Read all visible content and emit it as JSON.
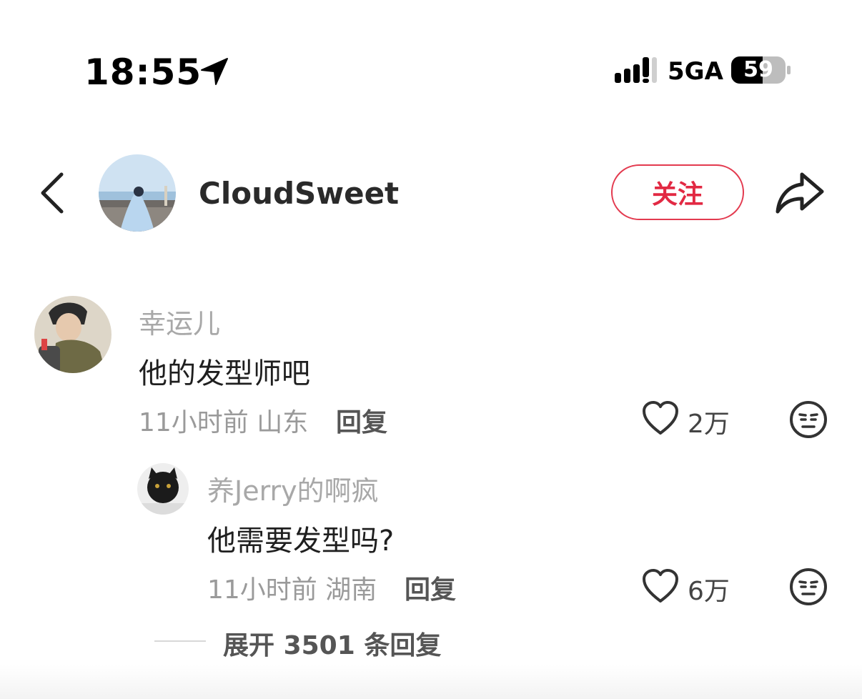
{
  "status_bar": {
    "time": "18:55",
    "network": "5GA",
    "battery": "59"
  },
  "header": {
    "username": "CloudSweet",
    "follow_label": "关注"
  },
  "comments": [
    {
      "author": "幸运儿",
      "text": "他的发型师吧",
      "time": "11小时前",
      "location": "山东",
      "reply_label": "回复",
      "likes": "2万"
    },
    {
      "author": "养Jerry的啊疯",
      "text": "他需要发型吗?",
      "time": "11小时前",
      "location": "湖南",
      "reply_label": "回复",
      "likes": "6万"
    }
  ],
  "expand": {
    "prefix": "展开",
    "count": "3501",
    "suffix": "条回复"
  },
  "colors": {
    "accent": "#e22943",
    "muted_text": "#9a9a9a"
  }
}
